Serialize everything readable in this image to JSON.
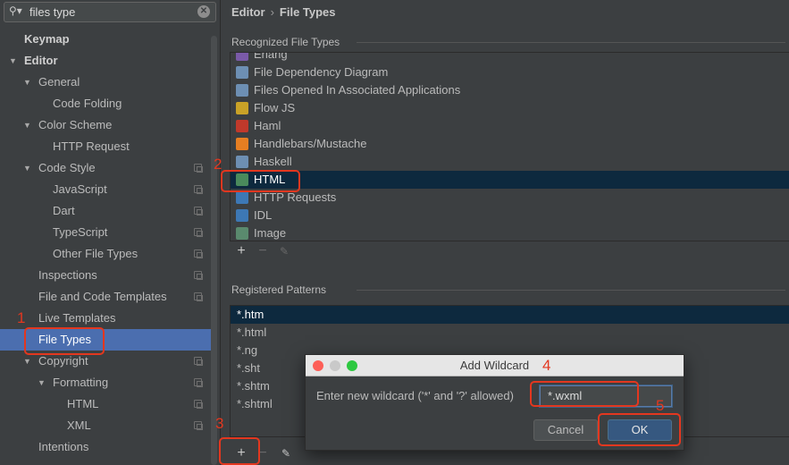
{
  "search": {
    "value": "files type",
    "icon": "search-icon"
  },
  "sidebar": {
    "items": [
      {
        "label": "Keymap",
        "level": 0,
        "arrow": false,
        "bold": true,
        "copy": false
      },
      {
        "label": "Editor",
        "level": 0,
        "arrow": true,
        "bold": true,
        "copy": false
      },
      {
        "label": "General",
        "level": 1,
        "arrow": true,
        "copy": false
      },
      {
        "label": "Code Folding",
        "level": 2,
        "arrow": false,
        "copy": false
      },
      {
        "label": "Color Scheme",
        "level": 1,
        "arrow": true,
        "copy": false
      },
      {
        "label": "HTTP Request",
        "level": 2,
        "arrow": false,
        "copy": false
      },
      {
        "label": "Code Style",
        "level": 1,
        "arrow": true,
        "copy": true
      },
      {
        "label": "JavaScript",
        "level": 2,
        "arrow": false,
        "copy": true
      },
      {
        "label": "Dart",
        "level": 2,
        "arrow": false,
        "copy": true
      },
      {
        "label": "TypeScript",
        "level": 2,
        "arrow": false,
        "copy": true
      },
      {
        "label": "Other File Types",
        "level": 2,
        "arrow": false,
        "copy": true
      },
      {
        "label": "Inspections",
        "level": 1,
        "arrow": false,
        "copy": true
      },
      {
        "label": "File and Code Templates",
        "level": 1,
        "arrow": false,
        "copy": true
      },
      {
        "label": "Live Templates",
        "level": 1,
        "arrow": false,
        "copy": false
      },
      {
        "label": "File Types",
        "level": 1,
        "arrow": false,
        "copy": false,
        "selected": true
      },
      {
        "label": "Copyright",
        "level": 1,
        "arrow": true,
        "copy": true
      },
      {
        "label": "Formatting",
        "level": 2,
        "arrow": true,
        "copy": true
      },
      {
        "label": "HTML",
        "level": 3,
        "arrow": false,
        "copy": true
      },
      {
        "label": "XML",
        "level": 3,
        "arrow": false,
        "copy": true
      },
      {
        "label": "Intentions",
        "level": 1,
        "arrow": false,
        "copy": false
      }
    ]
  },
  "breadcrumb": {
    "parent": "Editor",
    "current": "File Types"
  },
  "recognized": {
    "header": "Recognized File Types",
    "items": [
      {
        "label": "Erlang",
        "color": "#7a5aa8"
      },
      {
        "label": "File Dependency Diagram",
        "color": "#6d8fb3"
      },
      {
        "label": "Files Opened In Associated Applications",
        "color": "#6d8fb3"
      },
      {
        "label": "Flow JS",
        "color": "#c9a227"
      },
      {
        "label": "Haml",
        "color": "#c0392b"
      },
      {
        "label": "Handlebars/Mustache",
        "color": "#e67e22"
      },
      {
        "label": "Haskell",
        "color": "#6d8fb3"
      },
      {
        "label": "HTML",
        "color": "#4a8a5c",
        "selected": true
      },
      {
        "label": "HTTP Requests",
        "color": "#3d78b5"
      },
      {
        "label": "IDL",
        "color": "#3d78b5"
      },
      {
        "label": "Image",
        "color": "#5a8a6e"
      }
    ]
  },
  "patterns": {
    "header": "Registered Patterns",
    "items": [
      {
        "label": "*.htm",
        "selected": true
      },
      {
        "label": "*.html"
      },
      {
        "label": "*.ng"
      },
      {
        "label": "*.sht"
      },
      {
        "label": "*.shtm"
      },
      {
        "label": "*.shtml"
      }
    ]
  },
  "toolbar": {
    "add": "+",
    "remove": "−",
    "edit": "✎"
  },
  "dialog": {
    "title": "Add Wildcard",
    "prompt": "Enter new wildcard ('*' and '?' allowed)",
    "value": "*.wxml",
    "cancel": "Cancel",
    "ok": "OK"
  },
  "annotations": [
    "1",
    "2",
    "3",
    "4",
    "5"
  ],
  "colors": {
    "accent": "#4b6eaf",
    "annotation": "#e3371f",
    "selected_row": "#0d293e"
  }
}
